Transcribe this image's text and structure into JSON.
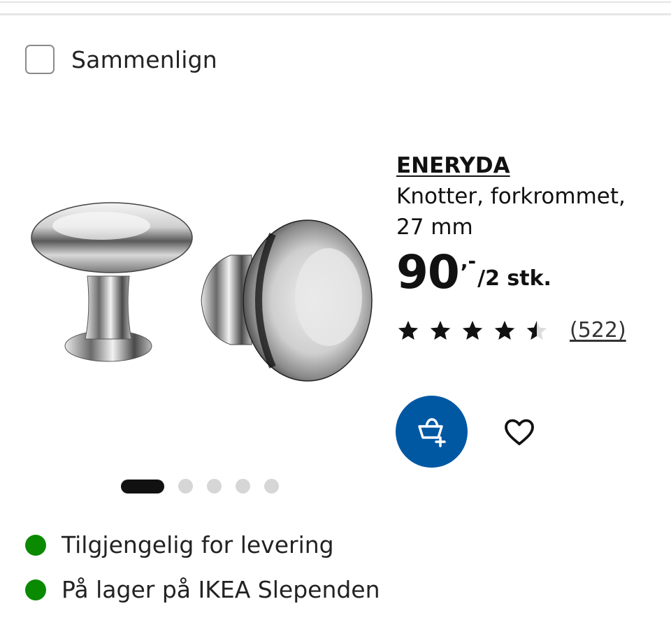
{
  "compare": {
    "label": "Sammenlign"
  },
  "product": {
    "name": "ENERYDA",
    "description_line1": "Knotter, forkrommet,",
    "description_line2": "27 mm",
    "price_amount": "90",
    "price_decimals": ",-",
    "price_unit": "/2 stk.",
    "rating_stars": 4.5,
    "rating_max": 5,
    "review_count": "(522)"
  },
  "carousel": {
    "slides": 5,
    "active": 0
  },
  "colors": {
    "accent_blue": "#0058a3",
    "stock_green": "#0a8a00",
    "text": "#111111"
  },
  "actions": {
    "add_to_cart_icon": "add-to-cart-icon",
    "favourite_icon": "heart-icon"
  },
  "availability": [
    {
      "text": "Tilgjengelig for levering"
    },
    {
      "text": "På lager på IKEA Slependen"
    }
  ]
}
